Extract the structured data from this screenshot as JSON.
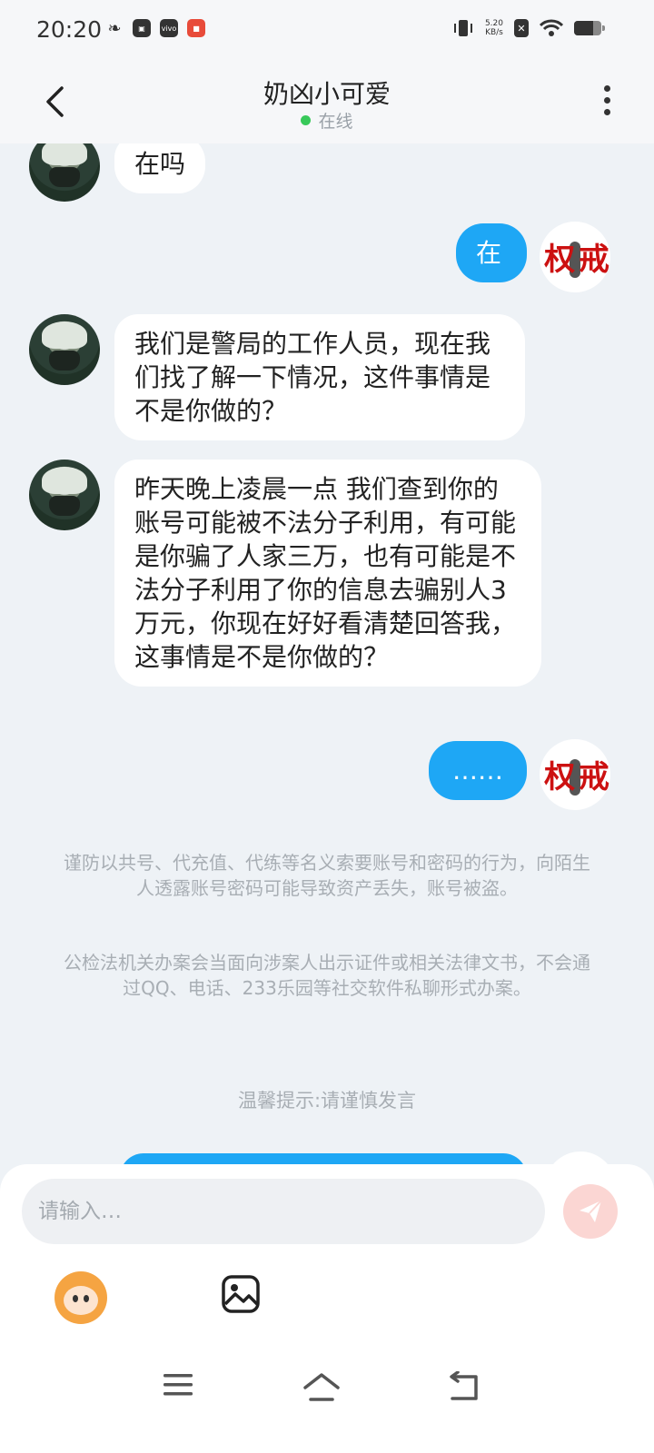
{
  "status_bar": {
    "time": "20:20",
    "net_speed_value": "5.20",
    "net_speed_unit": "KB/s",
    "icons": [
      "leaf-icon",
      "bag-icon",
      "vivo-icon",
      "app-icon",
      "vibrate-icon",
      "x-icon",
      "wifi-icon",
      "battery-icon"
    ]
  },
  "header": {
    "title": "奶凶小可爱",
    "status": "在线",
    "status_color": "#38c95a"
  },
  "messages": [
    {
      "side": "in",
      "text": "在吗"
    },
    {
      "side": "out",
      "text": "在"
    },
    {
      "side": "in",
      "text": "我们是警局的工作人员，现在我们找了解一下情况，这件事情是不是你做的？"
    },
    {
      "side": "in",
      "text": "昨天晚上凌晨一点 我们查到你的账号可能被不法分子利用，有可能是你骗了人家三万，也有可能是不法分子利用了你的信息去骗别人3万元，你现在好好看清楚回答我，这事情是不是你做的？"
    },
    {
      "side": "out",
      "text": "……"
    }
  ],
  "notices": {
    "notice1": "谨防以共号、代充值、代练等名义索要账号和密码的行为，向陌生人透露账号密码可能导致资产丢失，账号被盗。",
    "notice2": "公检法机关办案会当面向涉案人出示证件或相关法律文书，不会通过QQ、电话、233乐园等社交软件私聊形式办案。",
    "tip": "温馨提示:请谨慎发言"
  },
  "input": {
    "placeholder": "请输入…",
    "value": ""
  },
  "colors": {
    "outgoing_bubble": "#1ea7f5",
    "incoming_bubble": "#ffffff",
    "send_button": "#fbd6d3"
  }
}
